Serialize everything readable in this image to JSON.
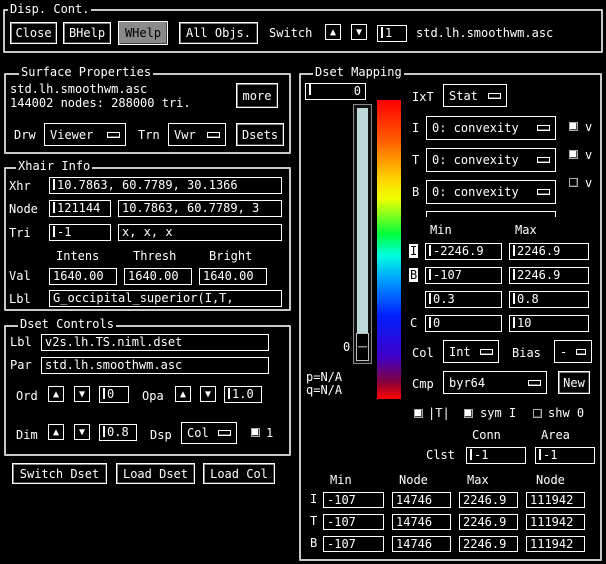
{
  "disp": {
    "title": "Disp. Cont.",
    "close": "Close",
    "bhelp": "BHelp",
    "whelp": "WHelp",
    "all_objs": "All Objs.",
    "switch_label": "Switch",
    "switch_value": "1",
    "surface_name": "std.lh.smoothwm.asc"
  },
  "surface": {
    "title": "Surface Properties",
    "name": "std.lh.smoothwm.asc",
    "stats": "144002 nodes: 288000 tri.",
    "more": "more",
    "drw_label": "Drw",
    "drw_value": "Viewer",
    "trn_label": "Trn",
    "trn_value": "Vwr",
    "dsets": "Dsets"
  },
  "xhair": {
    "title": "Xhair Info",
    "xhr_label": "Xhr",
    "xhr_value": "10.7863, 60.7789, 30.1366",
    "node_label": "Node",
    "node_id": "121144",
    "node_xyz": "10.7863, 60.7789, 3",
    "tri_label": "Tri",
    "tri_id": "-1",
    "tri_value": "x, x, x",
    "col_intens": "Intens",
    "col_thresh": "Thresh",
    "col_bright": "Bright",
    "val_label": "Val",
    "val_intens": "1640.00",
    "val_thresh": "1640.00",
    "val_bright": "1640.00",
    "lbl_label": "Lbl",
    "lbl_value": "G_occipital_superior(I,T,"
  },
  "dset_controls": {
    "title": "Dset Controls",
    "lbl_label": "Lbl",
    "lbl_value": "v2s.lh.TS.niml.dset",
    "par_label": "Par",
    "par_value": "std.lh.smoothwm.asc",
    "ord_label": "Ord",
    "ord_value": "0",
    "opa_label": "Opa",
    "opa_value": "1.0",
    "dim_label": "Dim",
    "dim_value": "0.8",
    "dsp_label": "Dsp",
    "dsp_value": "Col",
    "one": "1",
    "switch_dset": "Switch Dset",
    "load_dset": "Load Dset",
    "load_col": "Load Col"
  },
  "mapping": {
    "title": "Dset Mapping",
    "scale_value": "0",
    "scale_bottom": "0",
    "pq_p": "p=N/A",
    "pq_q": "q=N/A",
    "ixt_label": "IxT",
    "ixt_value": "Stat",
    "i_label": "I",
    "i_value": "0: convexity",
    "i_v": "v",
    "t_label": "T",
    "t_value": "0: convexity",
    "t_v": "v",
    "b_label": "B",
    "b_value": "0: convexity",
    "b_v": "v",
    "min_hdr": "Min",
    "max_hdr": "Max",
    "row_i_tag": "I",
    "row_i_min": "-2246.9",
    "row_i_max": "2246.9",
    "row_b_tag": "B",
    "row_b_min": "-107",
    "row_b_max": "2246.9",
    "row_x_min": "0.3",
    "row_x_max": "0.8",
    "c_label": "C",
    "row_c_min": "0",
    "row_c_max": "10",
    "col_label": "Col",
    "col_value": "Int",
    "bias_label": "Bias",
    "bias_value": "-",
    "cmp_label": "Cmp",
    "cmp_value": "byr64",
    "new": "New",
    "abs_t": "|T|",
    "sym_i": "sym I",
    "shw_0": "shw 0",
    "conn": "Conn",
    "area": "Area",
    "clst_label": "Clst",
    "clst_conn": "-1",
    "clst_area": "-1",
    "table": {
      "headers": [
        "Min",
        "Node",
        "Max",
        "Node"
      ],
      "rows": [
        {
          "tag": "I",
          "min": "-107",
          "node1": "14746",
          "max": "2246.9",
          "node2": "111942"
        },
        {
          "tag": "T",
          "min": "-107",
          "node1": "14746",
          "max": "2246.9",
          "node2": "111942"
        },
        {
          "tag": "B",
          "min": "-107",
          "node1": "14746",
          "max": "2246.9",
          "node2": "111942"
        }
      ]
    }
  }
}
